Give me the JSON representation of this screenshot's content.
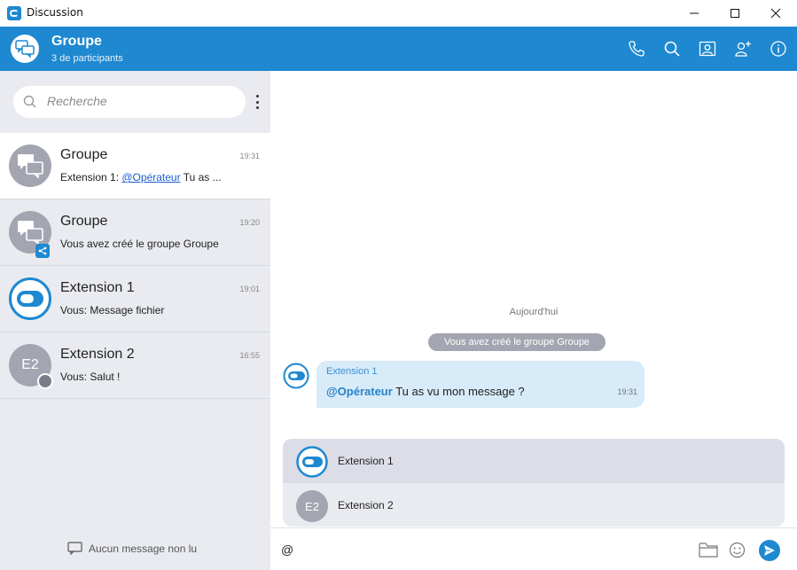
{
  "window": {
    "title": "Discussion",
    "controls": [
      "minimize",
      "maximize",
      "close"
    ]
  },
  "header": {
    "title": "Groupe",
    "subtitle": "3 de participants",
    "icons": [
      "phone-icon",
      "search-icon",
      "contact-card-icon",
      "add-user-icon",
      "info-icon"
    ]
  },
  "sidebar": {
    "search": {
      "placeholder": "Recherche",
      "value": ""
    },
    "conversations": [
      {
        "name": "Groupe",
        "time": "19:31",
        "preview_prefix": "Extension 1: ",
        "preview_mention": "@Opérateur",
        "preview_suffix": " Tu as ...",
        "avatar": "group-chat-icon",
        "active": true
      },
      {
        "name": "Groupe",
        "time": "19:20",
        "preview": "Vous avez créé le groupe Groupe",
        "avatar": "group-chat-icon",
        "badge": "share-icon"
      },
      {
        "name": "Extension 1",
        "time": "19:01",
        "preview": "Vous: Message fichier",
        "avatar": "app-logo-icon"
      },
      {
        "name": "Extension 2",
        "time": "16:55",
        "preview": "Vous: Salut !",
        "avatar_initials": "E2",
        "presence": "offline"
      }
    ],
    "footer": "Aucun message non lu"
  },
  "chat": {
    "date_separator": "Aujourd'hui",
    "system_message": "Vous avez créé le groupe Groupe",
    "messages": [
      {
        "sender": "Extension 1",
        "mention": "@Opérateur",
        "text": " Tu as vu mon message ?",
        "time": "19:31"
      }
    ],
    "mention_suggestions": [
      {
        "name": "Extension 1",
        "avatar": "app-logo-icon",
        "selected": true
      },
      {
        "name": "Extension 2",
        "avatar_initials": "E2",
        "selected": false
      }
    ],
    "composer": {
      "value": "@"
    }
  },
  "colors": {
    "accent": "#1e88d0",
    "sidebar_bg": "#e9ebf0",
    "avatar_gray": "#a3a6b0",
    "bubble_bg": "#d7ebf9"
  }
}
